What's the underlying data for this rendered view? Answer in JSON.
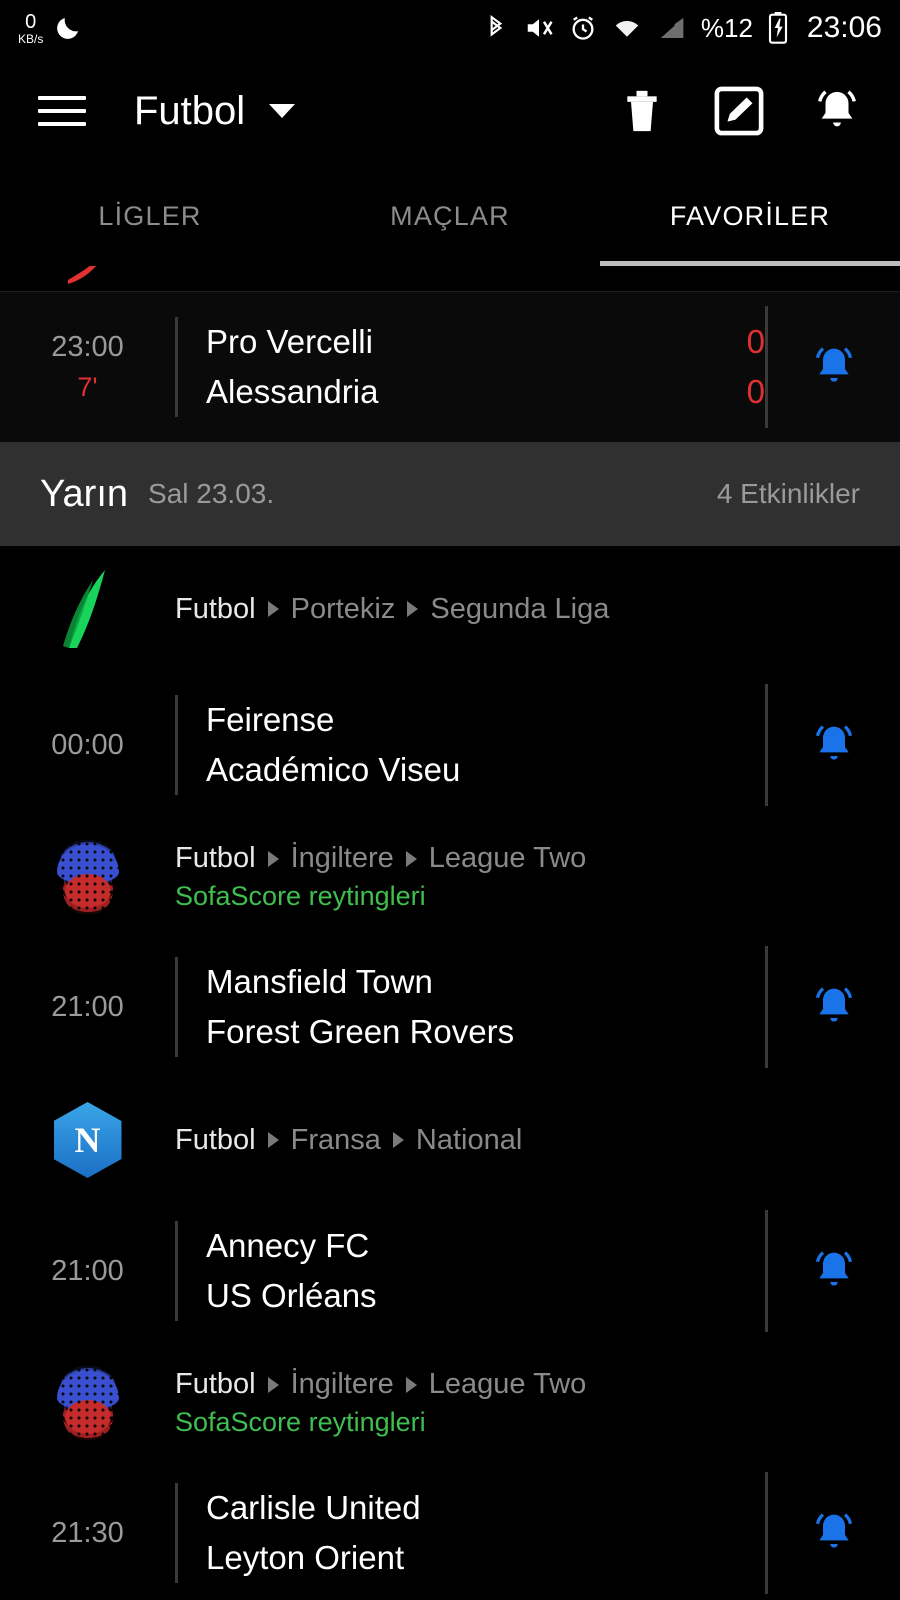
{
  "status_bar": {
    "net_speed_value": "0",
    "net_speed_unit": "KB/s",
    "battery_text": "%12",
    "clock": "23:06",
    "icons": [
      "moon-icon",
      "bluetooth-icon",
      "mute-icon",
      "alarm-icon",
      "wifi-icon",
      "signal-icon",
      "battery-charging-icon"
    ]
  },
  "app_bar": {
    "title": "Futbol",
    "menu_icon": "hamburger-icon",
    "dropdown_icon": "chevron-down-icon",
    "actions": [
      "trash-icon",
      "edit-icon",
      "notification-bell-icon"
    ]
  },
  "tabs": {
    "items": [
      {
        "label": "LİGLER",
        "active": false
      },
      {
        "label": "MAÇLAR",
        "active": false
      },
      {
        "label": "FAVORİLER",
        "active": true
      }
    ]
  },
  "live_match": {
    "time": "23:00",
    "minute": "7'",
    "home_team": "Pro Vercelli",
    "away_team": "Alessandria",
    "home_score": "0",
    "away_score": "0",
    "bell_icon": "notification-bell-icon"
  },
  "day_header": {
    "title": "Yarın",
    "date": "Sal 23.03.",
    "count": "4 Etkinlikler"
  },
  "groups": [
    {
      "logo": "green-swoosh-logo",
      "sport": "Futbol",
      "country": "Portekiz",
      "league": "Segunda Liga",
      "subtitle": "",
      "matches": [
        {
          "time": "00:00",
          "home_team": "Feirense",
          "away_team": "Académico Viseu",
          "bell_icon": "notification-bell-icon"
        }
      ]
    },
    {
      "logo": "sofascore-logo",
      "sport": "Futbol",
      "country": "İngiltere",
      "league": "League Two",
      "subtitle": "SofaScore reytingleri",
      "matches": [
        {
          "time": "21:00",
          "home_team": "Mansfield Town",
          "away_team": "Forest Green Rovers",
          "bell_icon": "notification-bell-icon"
        }
      ]
    },
    {
      "logo": "national-hexagon-logo",
      "sport": "Futbol",
      "country": "Fransa",
      "league": "National",
      "subtitle": "",
      "matches": [
        {
          "time": "21:00",
          "home_team": "Annecy FC",
          "away_team": "US Orléans",
          "bell_icon": "notification-bell-icon"
        }
      ]
    },
    {
      "logo": "sofascore-logo",
      "sport": "Futbol",
      "country": "İngiltere",
      "league": "League Two",
      "subtitle": "SofaScore reytingleri",
      "matches": [
        {
          "time": "21:30",
          "home_team": "Carlisle United",
          "away_team": "Leyton Orient",
          "bell_icon": "notification-bell-icon"
        }
      ]
    }
  ],
  "colors": {
    "accent_bell": "#1a73e8",
    "live_red": "#e03131",
    "sub_green": "#3fbf4f",
    "day_header_bg": "#303030"
  }
}
